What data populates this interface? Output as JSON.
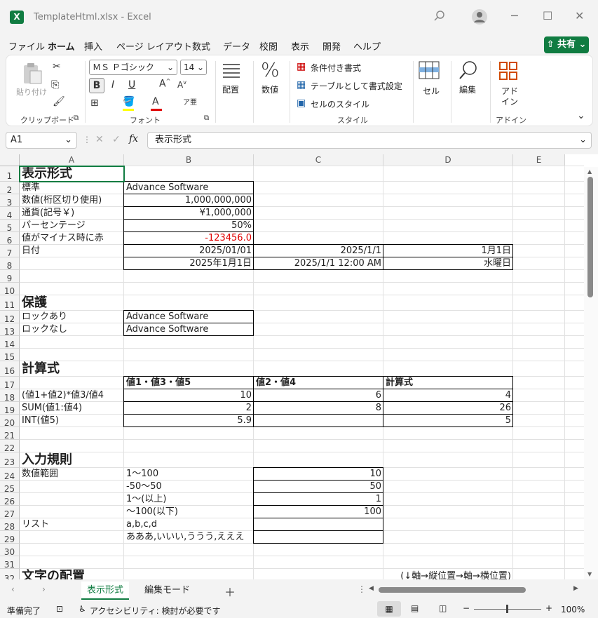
{
  "window": {
    "title": "TemplateHtml.xlsx  -  Excel",
    "logo": "X"
  },
  "menu": [
    "ファイル",
    "ホーム",
    "挿入",
    "ページ レイアウト",
    "数式",
    "データ",
    "校閲",
    "表示",
    "開発",
    "ヘルプ"
  ],
  "share_label": "共有",
  "ribbon": {
    "clipboard": {
      "paste": "貼り付け",
      "group": "クリップボード"
    },
    "font": {
      "name": "ＭＳ Ｐゴシック",
      "size": "14",
      "group": "フォント",
      "bold": "B",
      "italic": "I",
      "underline": "U"
    },
    "alignment": {
      "label": "配置"
    },
    "number": {
      "label": "数値"
    },
    "styles": {
      "cond": "条件付き書式",
      "table": "テーブルとして書式設定",
      "cell": "セルのスタイル",
      "group": "スタイル"
    },
    "cells": {
      "label": "セル"
    },
    "editing": {
      "label": "編集"
    },
    "addin": {
      "label1": "アド",
      "label2": "イン",
      "group": "アドイン"
    }
  },
  "formula_bar": {
    "name_box": "A1",
    "fx": "fx",
    "value": "表示形式"
  },
  "columns": [
    "A",
    "B",
    "C",
    "D",
    "E"
  ],
  "rows": [
    "1",
    "2",
    "3",
    "4",
    "5",
    "6",
    "7",
    "8",
    "9",
    "10",
    "11",
    "12",
    "13",
    "14",
    "15",
    "16",
    "17",
    "18",
    "19",
    "20",
    "21",
    "22",
    "23",
    "24",
    "25",
    "26",
    "27",
    "28",
    "29",
    "30",
    "31",
    "32"
  ],
  "cells": {
    "A1": "表示形式",
    "A2": "標準",
    "B2": "Advance Software",
    "A3": "数値(桁区切り使用)",
    "B3": "1,000,000,000",
    "A4": "通貨(記号￥)",
    "B4": "¥1,000,000",
    "A5": "パーセンテージ",
    "B5": "50%",
    "A6": "値がマイナス時に赤",
    "B6": "-123456.0",
    "A7": "日付",
    "B7": "2025/01/01",
    "C7": "2025/1/1",
    "D7": "1月1日",
    "B8": "2025年1月1日",
    "C8": "2025/1/1 12:00 AM",
    "D8": "水曜日",
    "A11": "保護",
    "A12": "ロックあり",
    "B12": "Advance Software",
    "A13": "ロックなし",
    "B13": "Advance Software",
    "A16": "計算式",
    "B17": "値1・値3・値5",
    "C17": "値2・値4",
    "D17": "計算式",
    "A18": "(値1+値2)*値3/値4",
    "B18": "10",
    "C18": "6",
    "D18": "4",
    "A19": "SUM(値1:値4)",
    "B19": "2",
    "C19": "8",
    "D19": "26",
    "A20": "INT(値5)",
    "B20": "5.9",
    "D20": "5",
    "A23": "入力規則",
    "A24": "数値範囲",
    "B24": "1～100",
    "C24": "10",
    "B25": "-50～50",
    "C25": "50",
    "B26": "1～(以上)",
    "C26": "1",
    "B27": "～100(以下)",
    "C27": "100",
    "A28": "リスト",
    "B28": "a,b,c,d",
    "B29": "あああ,いいい,ううう,えええ",
    "A32": "文字の配置",
    "C32": "(↓軸→縦位置→軸→横位置)"
  },
  "sheets": [
    "表示形式",
    "編集モード"
  ],
  "status": {
    "ready": "準備完了",
    "accessibility": "アクセシビリティ: 検討が必要です",
    "zoom": "100%"
  },
  "colors": {
    "accent": "#107c41",
    "negative": "#e00000"
  }
}
